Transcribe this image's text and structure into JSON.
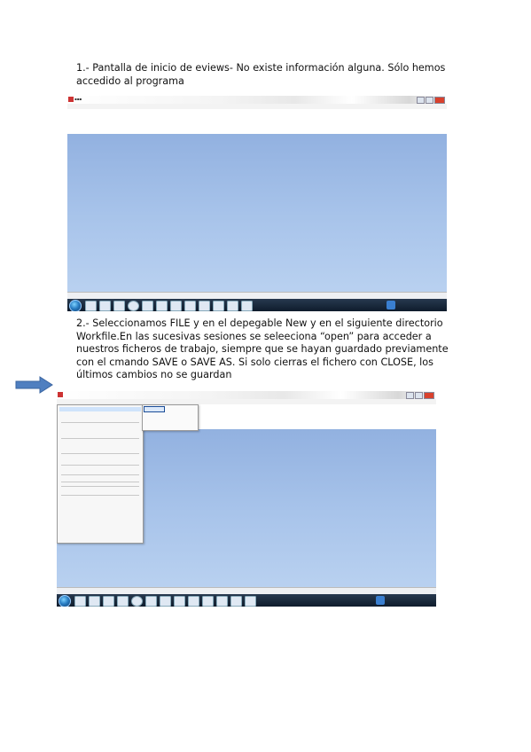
{
  "paragraph1": "1.- Pantalla de inicio de eviews- No existe información alguna. Sólo hemos accedido al programa",
  "paragraph2": "2.- Seleccionamos FILE y en el depegable New y en el siguiente directorio Workfile.En las sucesivas sesiones se seleeciona “open” para acceder a nuestros ficheros de trabajo, siempre que se hayan guardado previamente con el cmando SAVE o SAVE AS. Si solo cierras el fichero con CLOSE, los últimos cambios no se guardan",
  "colors": {
    "desktop": "#a7c3ea",
    "taskbar": "#1a2a3f",
    "arrow": "#4f7fc0",
    "close_button": "#d9412d"
  },
  "icons": [
    "right-arrow-icon",
    "eviews-app-icon",
    "windows-start-icon",
    "browser-icon",
    "folder-icon",
    "chart-icon"
  ]
}
